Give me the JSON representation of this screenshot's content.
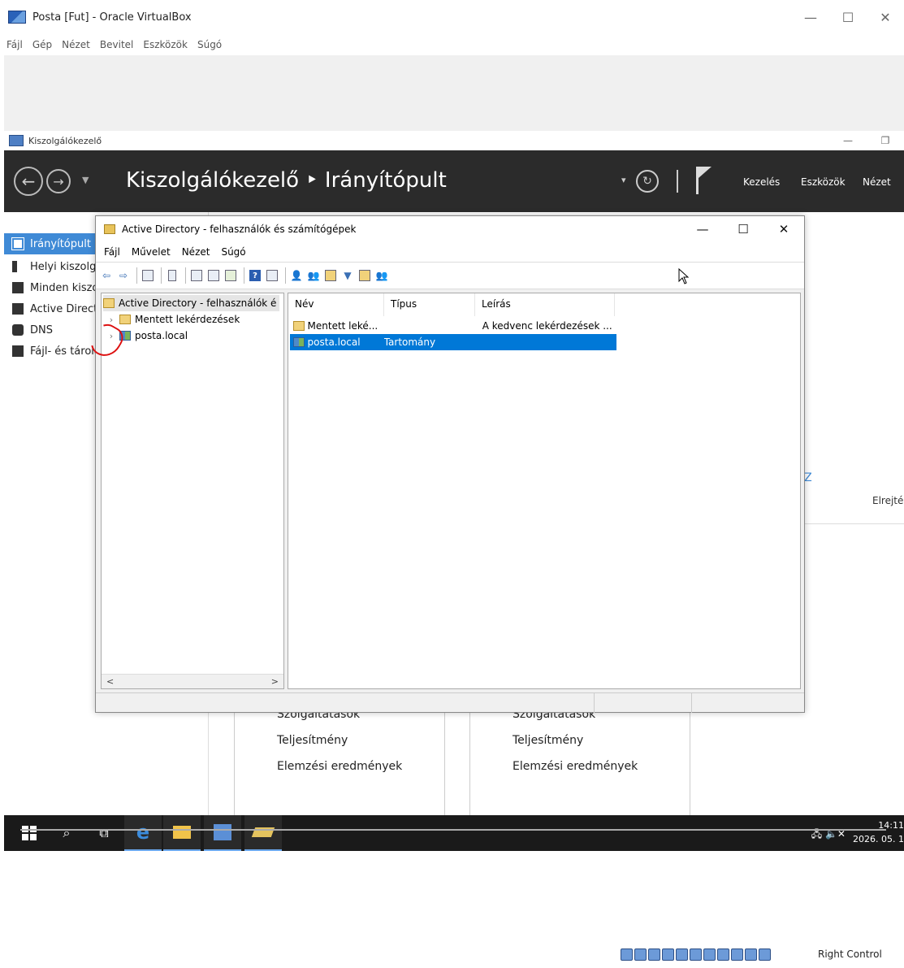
{
  "vbox": {
    "title": "Posta [Fut] - Oracle VirtualBox",
    "menu": [
      "Fájl",
      "Gép",
      "Nézet",
      "Bevitel",
      "Eszközök",
      "Súgó"
    ],
    "min": "—",
    "max": "☐",
    "close": "✕",
    "status_host_key": "Right Control"
  },
  "server_manager": {
    "window_title": "Kiszolgálókezelő",
    "breadcrumb": "Kiszolgálókezelő ‣ Irányítópult",
    "menu": [
      "Kezelés",
      "Eszközök",
      "Nézet"
    ],
    "sidebar": [
      {
        "label": "Irányítópult",
        "active": true
      },
      {
        "label": "Helyi kiszolgáló",
        "active": false
      },
      {
        "label": "Minden kiszolgáló",
        "active": false
      },
      {
        "label": "Active Directory",
        "active": false
      },
      {
        "label": "DNS",
        "active": false
      },
      {
        "label": "Fájl- és tárolási szolgáltatások",
        "active": false
      }
    ],
    "tile_left_rows": [
      "Szolgáltatások",
      "Teljesítmény",
      "Elemzési eredmények"
    ],
    "tile_right_rows": [
      "Szolgáltatások",
      "Teljesítmény",
      "Elemzési eredmények"
    ],
    "link_partial": "IOZ",
    "hide_partial": "Elrejté"
  },
  "ad_window": {
    "title": "Active Directory - felhasználók és számítógépek",
    "min": "—",
    "max": "☐",
    "close": "✕",
    "menu": [
      "Fájl",
      "Művelet",
      "Nézet",
      "Súgó"
    ],
    "tree": {
      "root": "Active Directory - felhasználók é",
      "children": [
        "Mentett lekérdezések",
        "posta.local"
      ]
    },
    "columns": [
      "Név",
      "Típus",
      "Leírás"
    ],
    "rows": [
      {
        "name": "Mentett leké...",
        "type": "",
        "description": "A kedvenc lekérdezések ...",
        "selected": false,
        "icon": "folder-icon"
      },
      {
        "name": "posta.local",
        "type": "Tartomány",
        "description": "",
        "selected": true,
        "icon": "domain-icon"
      }
    ]
  },
  "taskbar": {
    "time": "14:11",
    "date": "2026. 05. 1"
  }
}
